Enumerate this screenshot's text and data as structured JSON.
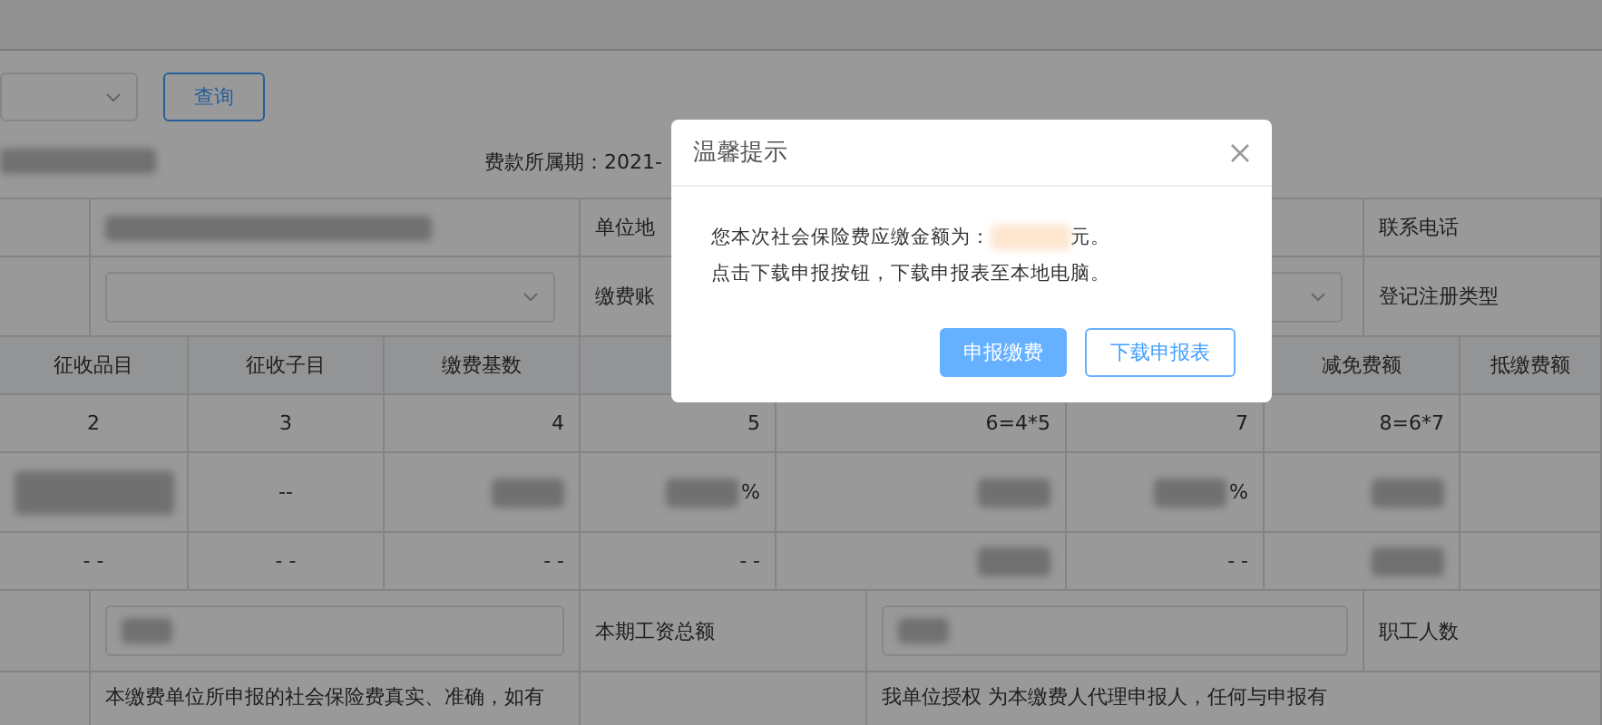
{
  "search": {
    "button": "查询"
  },
  "period_label": "费款所属期：2021-",
  "info_rows": [
    {
      "cells": [
        {
          "kind": "empty"
        },
        {
          "kind": "blurred"
        },
        {
          "kind": "label",
          "text": "单位地"
        },
        {
          "kind": "empty"
        },
        {
          "kind": "label",
          "text": "联系电话"
        }
      ]
    },
    {
      "cells": [
        {
          "kind": "empty"
        },
        {
          "kind": "select"
        },
        {
          "kind": "label",
          "text": "缴费账"
        },
        {
          "kind": "select"
        },
        {
          "kind": "label",
          "text": "登记注册类型"
        }
      ]
    }
  ],
  "fee_table": {
    "columns": [
      "征收品目",
      "征收子目",
      "缴费基数",
      null,
      null,
      null,
      "减免费额",
      "抵缴费额"
    ],
    "rows": [
      [
        {
          "kind": "text",
          "text": "2"
        },
        {
          "kind": "text",
          "text": "3"
        },
        {
          "kind": "text",
          "text": "4"
        },
        {
          "kind": "text",
          "text": "5"
        },
        {
          "kind": "text",
          "text": "6=4*5"
        },
        {
          "kind": "text",
          "text": "7"
        },
        {
          "kind": "text",
          "text": "8=6*7"
        },
        {
          "kind": "empty"
        }
      ],
      [
        {
          "kind": "blurred"
        },
        {
          "kind": "text",
          "text": "--"
        },
        {
          "kind": "blurred"
        },
        {
          "kind": "blurred",
          "suffix": "%"
        },
        {
          "kind": "blurred"
        },
        {
          "kind": "blurred",
          "suffix": "%"
        },
        {
          "kind": "blurred"
        },
        {
          "kind": "empty"
        }
      ],
      [
        {
          "kind": "text",
          "text": "- -"
        },
        {
          "kind": "text",
          "text": "- -"
        },
        {
          "kind": "text",
          "text": "- -"
        },
        {
          "kind": "text",
          "text": "- -"
        },
        {
          "kind": "blurred"
        },
        {
          "kind": "text",
          "text": "- -"
        },
        {
          "kind": "blurred"
        },
        {
          "kind": "empty"
        }
      ]
    ]
  },
  "wage_row": {
    "wage_label": "本期工资总额",
    "staff_label": "职工人数"
  },
  "declarations": [
    "本缴费单位所申报的社会保险费真实、准确，如有",
    "我单位授权 为本缴费人代理申报人，任何与申报有"
  ],
  "dialog": {
    "title": "温馨提示",
    "amount_prefix": "您本次社会保险费应缴金额为：",
    "amount_suffix": "元。",
    "hint": "点击下载申报按钮，下载申报表至本地电脑。",
    "buttons": [
      {
        "label": "申报缴费",
        "kind": "primary"
      },
      {
        "label": "下载申报表",
        "kind": "secondary"
      }
    ]
  }
}
